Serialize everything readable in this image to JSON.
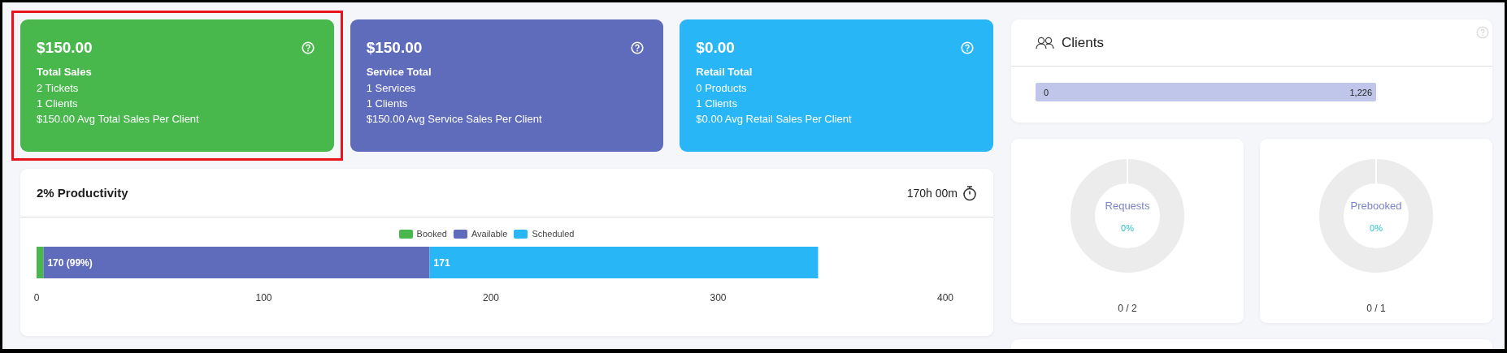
{
  "summary_cards": [
    {
      "amount": "$150.00",
      "title": "Total Sales",
      "lines": [
        "2 Tickets",
        "1 Clients",
        "$150.00 Avg Total Sales Per Client"
      ],
      "color": "#48b84c",
      "highlighted": true
    },
    {
      "amount": "$150.00",
      "title": "Service Total",
      "lines": [
        "1 Services",
        "1 Clients",
        "$150.00 Avg Service Sales Per Client"
      ],
      "color": "#5f6bbb",
      "highlighted": false
    },
    {
      "amount": "$0.00",
      "title": "Retail Total",
      "lines": [
        "0 Products",
        "1 Clients",
        "$0.00 Avg Retail Sales Per Client"
      ],
      "color": "#29b6f6",
      "highlighted": false
    }
  ],
  "productivity": {
    "title": "2% Productivity",
    "hours": "170h 00m",
    "chart_data": {
      "type": "bar",
      "orientation": "horizontal",
      "stacked": true,
      "series": [
        {
          "name": "Booked",
          "color": "#48b84c",
          "values": [
            3
          ]
        },
        {
          "name": "Available",
          "color": "#5f6bbb",
          "values": [
            170
          ]
        },
        {
          "name": "Scheduled",
          "color": "#29b6f6",
          "values": [
            171
          ]
        }
      ],
      "value_labels": [
        null,
        "170 (99%)",
        "171"
      ],
      "xlim": [
        0,
        400
      ],
      "xticks": [
        0,
        100,
        200,
        300,
        400
      ]
    }
  },
  "clients": {
    "title": "Clients",
    "bar_start": "0",
    "bar_end": "1,226"
  },
  "donuts": [
    {
      "label": "Requests",
      "percent": "0%",
      "ratio": "0 / 2"
    },
    {
      "label": "Prebooked",
      "percent": "0%",
      "ratio": "0 / 1"
    }
  ]
}
